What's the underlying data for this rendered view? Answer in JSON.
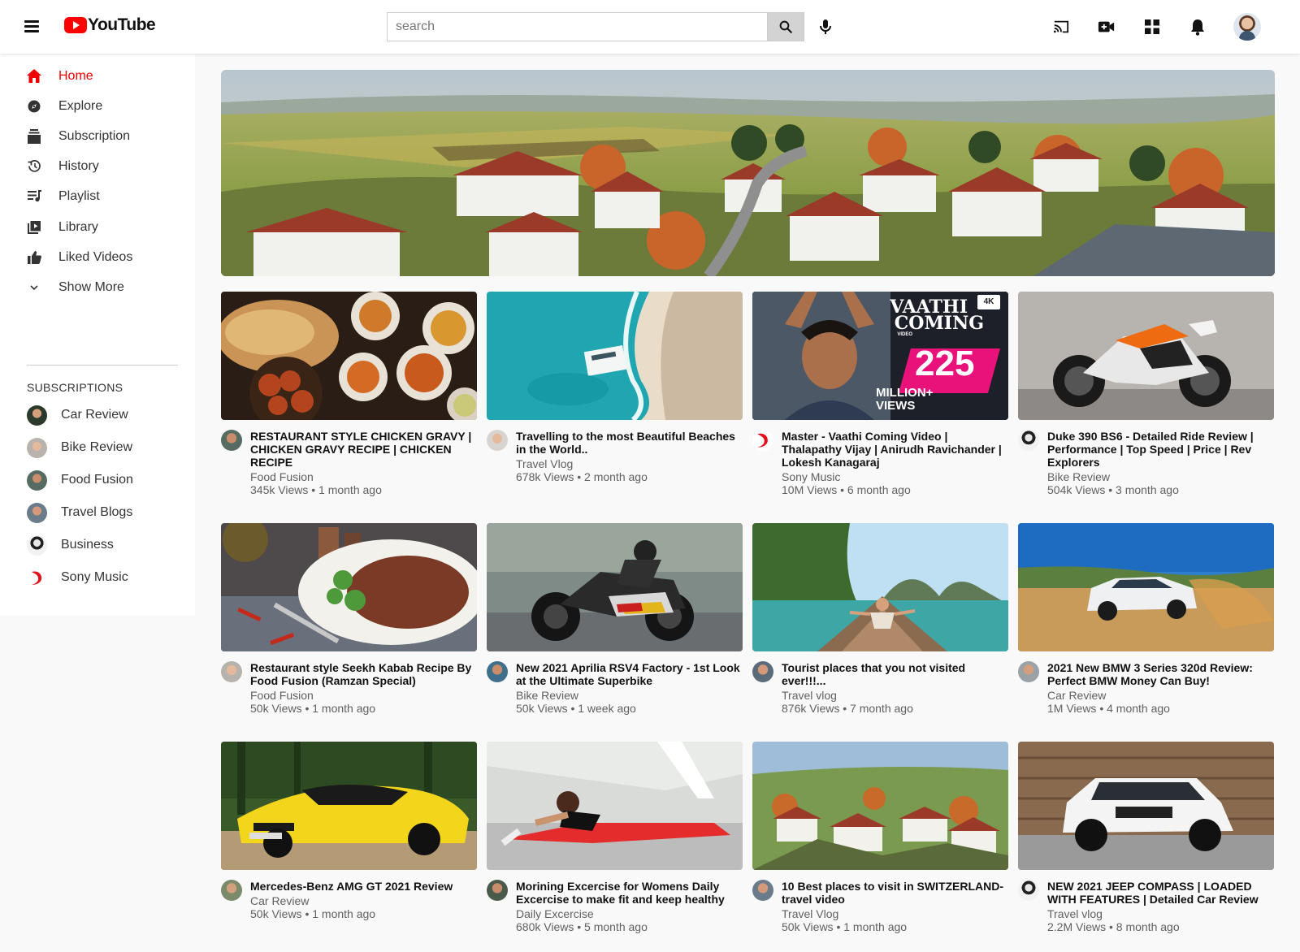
{
  "header": {
    "logo_text": "YouTube",
    "search_placeholder": "search"
  },
  "colors": {
    "brand": "#ff0000",
    "active": "#ee0000"
  },
  "sidebar": {
    "items": [
      {
        "label": "Home",
        "icon": "home-icon",
        "active": true
      },
      {
        "label": "Explore",
        "icon": "compass-icon"
      },
      {
        "label": "Subscription",
        "icon": "subscriptions-icon"
      },
      {
        "label": "History",
        "icon": "history-icon"
      },
      {
        "label": "Playlist",
        "icon": "playlist-icon"
      },
      {
        "label": "Library",
        "icon": "library-icon"
      },
      {
        "label": "Liked Videos",
        "icon": "thumbs-up-icon"
      },
      {
        "label": "Show More",
        "icon": "chevron-down-icon"
      }
    ],
    "subscriptions_title": "SUBSCRIPTIONS",
    "subscriptions": [
      {
        "label": "Car Review"
      },
      {
        "label": "Bike Review"
      },
      {
        "label": "Food Fusion"
      },
      {
        "label": "Travel Blogs"
      },
      {
        "label": "Business"
      },
      {
        "label": "Sony Music"
      }
    ]
  },
  "videos": [
    {
      "title": "RESTAURANT STYLE CHICKEN GRAVY | CHICKEN GRAVY RECIPE | CHICKEN RECIPE",
      "channel": "Food Fusion",
      "info": "345k Views • 1 month ago"
    },
    {
      "title": "Travelling to the most Beautiful Beaches in the World..",
      "channel": "Travel Vlog",
      "info": "678k Views • 2 month ago"
    },
    {
      "title": "Master - Vaathi Coming Video | Thalapathy Vijay | Anirudh Ravichander | Lokesh Kanagaraj",
      "channel": "Sony Music",
      "info": "10M Views • 6 month ago",
      "thumb_text": {
        "line1": "VAATHI",
        "line2": "COMING",
        "line3": "VIDEO",
        "number": "225",
        "line4": "MILLION+",
        "line5": "VIEWS",
        "badge": "4K"
      }
    },
    {
      "title": "Duke 390 BS6 - Detailed Ride Review | Performance | Top Speed | Price | Rev Explorers",
      "channel": "Bike Review",
      "info": "504k Views • 3 month ago"
    },
    {
      "title": "Restaurant style Seekh Kabab Recipe By Food Fusion (Ramzan Special)",
      "channel": "Food Fusion",
      "info": "50k Views • 1 month ago"
    },
    {
      "title": "New 2021 Aprilia RSV4 Factory - 1st Look at the Ultimate Superbike",
      "channel": "Bike Review",
      "info": "50k Views • 1 week ago"
    },
    {
      "title": "Tourist places that you not visited ever!!!...",
      "channel": "Travel vlog",
      "info": "876k Views • 7 month ago"
    },
    {
      "title": "2021 New BMW 3 Series 320d Review: Perfect BMW Money Can Buy!",
      "channel": "Car Review",
      "info": "1M Views • 4 month ago"
    },
    {
      "title": "Mercedes-Benz AMG GT 2021 Review",
      "channel": "Car Review",
      "info": "50k Views • 1 month ago"
    },
    {
      "title": "Morining Excercise for Womens Daily Excercise to make fit and keep healthy",
      "channel": "Daily Excercise",
      "info": "680k Views • 5 month ago"
    },
    {
      "title": "10 Best places to visit in SWITZERLAND-travel video",
      "channel": "Travel Vlog",
      "info": "50k Views • 1 month ago"
    },
    {
      "title": "NEW 2021 JEEP COMPASS | LOADED WITH FEATURES | Detailed Car Review",
      "channel": "Travel vlog",
      "info": "2.2M Views • 8 month ago"
    }
  ]
}
